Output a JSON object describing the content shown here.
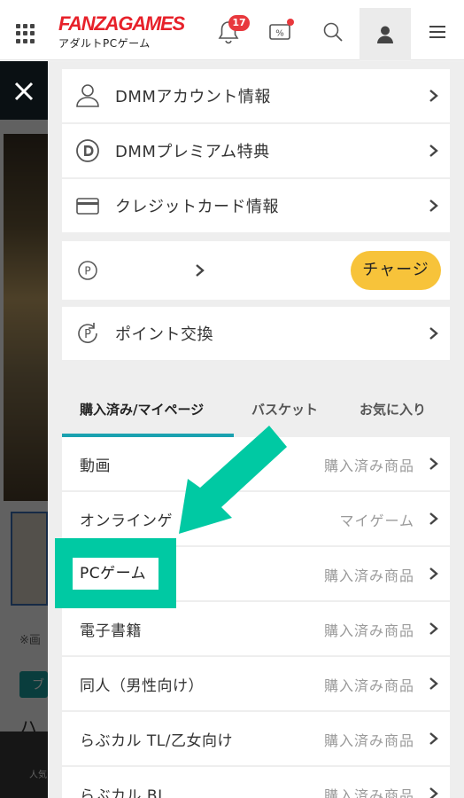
{
  "header": {
    "logo_main": "FANZAGAMES",
    "logo_sub": "アダルトPCゲーム",
    "notification_count": "17",
    "sale_icon_text": "%",
    "icons": [
      "grid-menu-icon",
      "bell-icon",
      "sale-icon",
      "search-icon",
      "account-icon",
      "hamburger-menu-icon"
    ]
  },
  "background_page": {
    "note": "※画",
    "tag": "ブ",
    "text": "ハ",
    "bottom_label": "人気"
  },
  "account_menu": [
    {
      "label": "DMMアカウント情報",
      "icon": "person-icon"
    },
    {
      "label": "DMMプレミアム特典",
      "icon": "premium-d-icon"
    },
    {
      "label": "クレジットカード情報",
      "icon": "credit-card-icon"
    },
    {
      "label": "",
      "icon": "point-icon",
      "action": "チャージ"
    },
    {
      "label": "ポイント交換",
      "icon": "point-exchange-icon"
    }
  ],
  "tabs": [
    {
      "label": "購入済み/マイページ",
      "active": true
    },
    {
      "label": "バスケット",
      "active": false
    },
    {
      "label": "お気に入り",
      "active": false
    }
  ],
  "list": [
    {
      "label": "動画",
      "sub": "購入済み商品"
    },
    {
      "label": "オンラインゲ",
      "sub": "マイゲーム"
    },
    {
      "label": "PCゲーム",
      "sub": "購入済み商品"
    },
    {
      "label": "電子書籍",
      "sub": "購入済み商品"
    },
    {
      "label": "同人（男性向け）",
      "sub": "購入済み商品"
    },
    {
      "label": "らぶカル TL/乙女向け",
      "sub": "購入済み商品"
    },
    {
      "label": "らぶカル BL",
      "sub": "購入済み商品"
    }
  ],
  "colors": {
    "brand_red": "#e7212a",
    "highlight": "#00c9a3",
    "tab_accent": "#1aa1b0",
    "charge_button": "#f7c33a",
    "badge": "#e8383d"
  }
}
